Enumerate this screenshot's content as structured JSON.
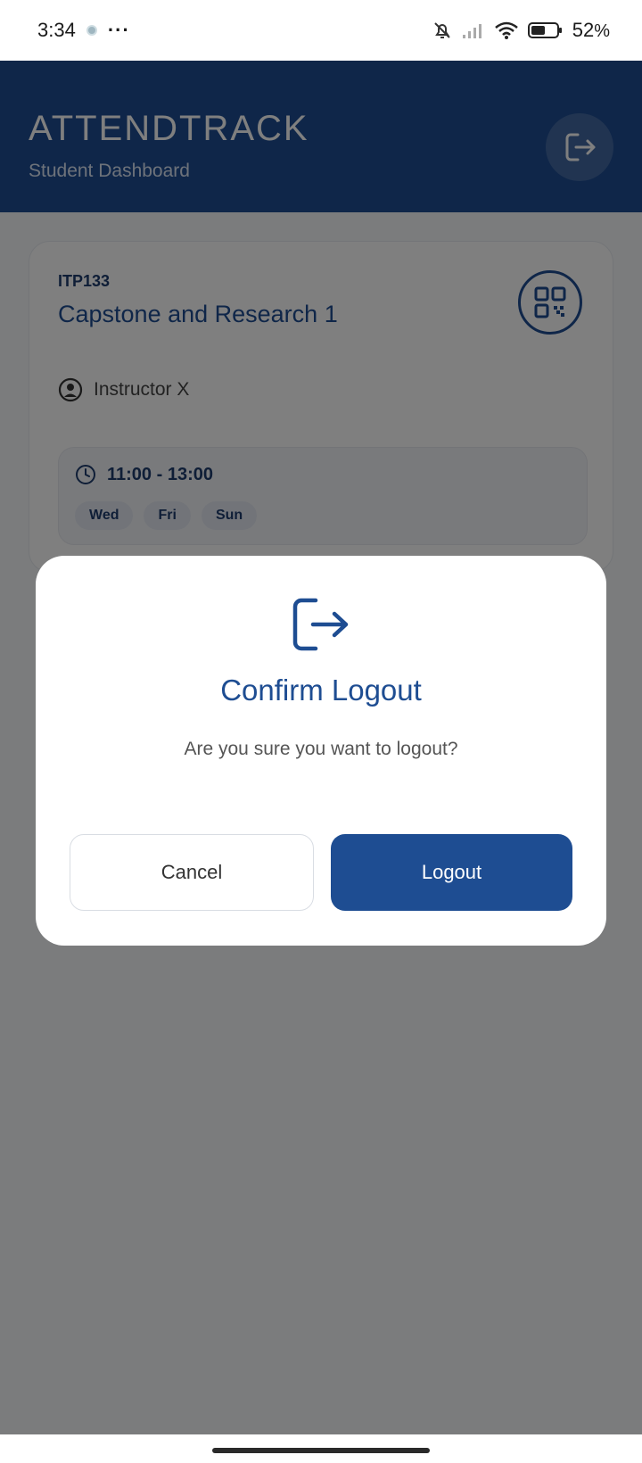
{
  "status_bar": {
    "time": "3:34",
    "more": "···",
    "battery_pct": "52",
    "battery_unit": "%",
    "icons": [
      "notification-dot-icon",
      "bell-off-icon",
      "signal-icon",
      "wifi-icon",
      "battery-icon"
    ]
  },
  "header": {
    "brand": "ATTENDTRACK",
    "subtitle": "Student Dashboard",
    "logout_icon": "logout-icon"
  },
  "course": {
    "code": "ITP133",
    "name": "Capstone and Research 1",
    "instructor": "Instructor X",
    "time": "11:00 - 13:00",
    "days": [
      "Wed",
      "Fri",
      "Sun"
    ],
    "qr_icon": "qr-code-icon"
  },
  "dialog": {
    "title": "Confirm Logout",
    "message": "Are you sure you want to logout?",
    "cancel_label": "Cancel",
    "logout_label": "Logout",
    "icon": "logout-icon"
  },
  "colors": {
    "primary": "#1e4d92",
    "overlay": "rgba(0,0,0,0.5)"
  }
}
